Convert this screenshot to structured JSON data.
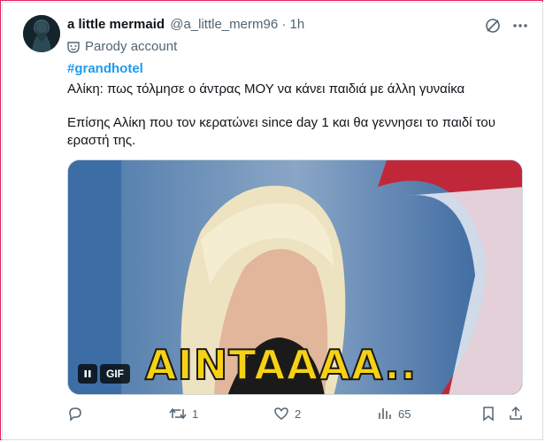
{
  "tweet": {
    "display_name": "a little mermaid",
    "handle_meta": "@a_little_merm96 · 1h",
    "parody_label": "Parody account",
    "hashtag": "#grandhotel",
    "line1": "Αλίκη: πως τόλμησε ο άντρας ΜΟΥ να κάνει παιδιά με άλλη γυναίκα",
    "line2": "Επίσης Αλίκη που τον κερατώνει since day 1  και θα γεννησει το παιδί του εραστή της."
  },
  "media": {
    "gif_label": "GIF",
    "caption": "AINTAAAA.."
  },
  "actions": {
    "replies": "",
    "reposts": "1",
    "likes": "2",
    "views": "65"
  },
  "colors": {
    "accent": "#1d9bf0",
    "text": "#0f1419",
    "muted": "#536471",
    "frame": "#e0245e"
  }
}
